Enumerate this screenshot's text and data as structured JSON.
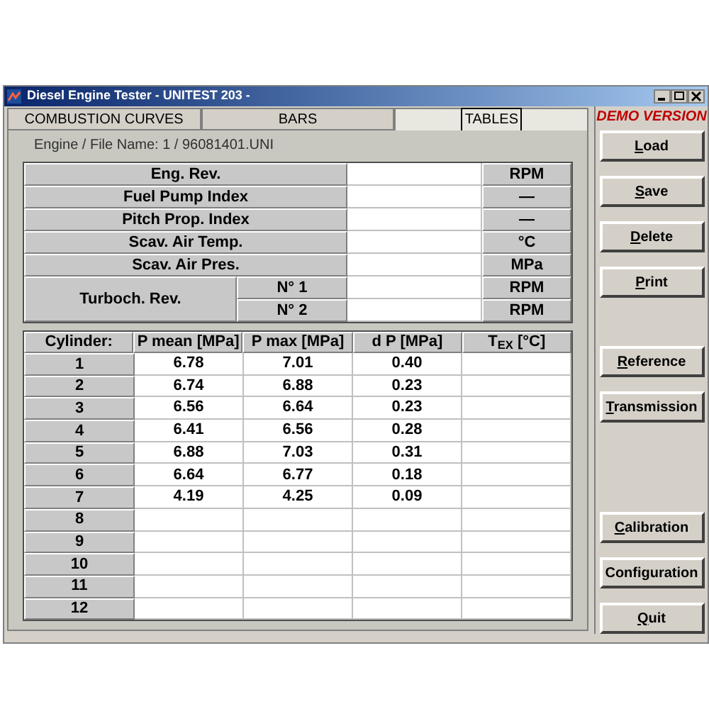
{
  "window": {
    "title": "Diesel Engine Tester  - UNITEST 203 -"
  },
  "tabs": [
    {
      "label": "COMBUSTION CURVES",
      "selected": false
    },
    {
      "label": "BARS",
      "selected": false
    },
    {
      "label": "TABLES",
      "selected": true
    }
  ],
  "file_name": "Engine / File Name: 1 / 96081401.UNI",
  "engine_table": {
    "rows": [
      {
        "label": "Eng. Rev.",
        "value": "",
        "unit": "RPM"
      },
      {
        "label": "Fuel Pump Index",
        "value": "",
        "unit": "—"
      },
      {
        "label": "Pitch Prop. Index",
        "value": "",
        "unit": "—"
      },
      {
        "label": "Scav. Air Temp.",
        "value": "",
        "unit": "°C"
      },
      {
        "label": "Scav. Air Pres.",
        "value": "",
        "unit": "MPa"
      }
    ],
    "turbo": {
      "label": "Turboch. Rev.",
      "subrows": [
        {
          "label": "N° 1",
          "value": "",
          "unit": "RPM"
        },
        {
          "label": "N° 2",
          "value": "",
          "unit": "RPM"
        }
      ]
    }
  },
  "cylinder_table": {
    "columns": [
      "Cylinder:",
      "P mean [MPa]",
      "P max [MPa]",
      "d P [MPa]",
      "T$_{EX}$ [°C]"
    ],
    "rows": [
      [
        "1",
        "6.78",
        "7.01",
        "0.40",
        ""
      ],
      [
        "2",
        "6.74",
        "6.88",
        "0.23",
        ""
      ],
      [
        "3",
        "6.56",
        "6.64",
        "0.23",
        ""
      ],
      [
        "4",
        "6.41",
        "6.56",
        "0.28",
        ""
      ],
      [
        "5",
        "6.88",
        "7.03",
        "0.31",
        ""
      ],
      [
        "6",
        "6.64",
        "6.77",
        "0.18",
        ""
      ],
      [
        "7",
        "4.19",
        "4.25",
        "0.09",
        ""
      ],
      [
        "8",
        "",
        "",
        "",
        ""
      ],
      [
        "9",
        "",
        "",
        "",
        ""
      ],
      [
        "10",
        "",
        "",
        "",
        ""
      ],
      [
        "11",
        "",
        "",
        "",
        ""
      ],
      [
        "12",
        "",
        "",
        "",
        ""
      ]
    ]
  },
  "demo_label": "DEMO VERSION",
  "button_groups": [
    [
      {
        "label": "Load",
        "underline_first": true
      },
      {
        "label": "Save",
        "underline_first": true
      },
      {
        "label": "Delete",
        "underline_first": true
      },
      {
        "label": "Print",
        "underline_first": true
      }
    ],
    [
      {
        "label": "Reference",
        "underline_first": true
      },
      {
        "label": "Transmission",
        "underline_first": true
      }
    ],
    [
      {
        "label": "Calibration",
        "underline_first": true
      },
      {
        "label": "Configuration",
        "underline_first": false
      },
      {
        "label": "Quit",
        "underline_first": true
      }
    ]
  ]
}
